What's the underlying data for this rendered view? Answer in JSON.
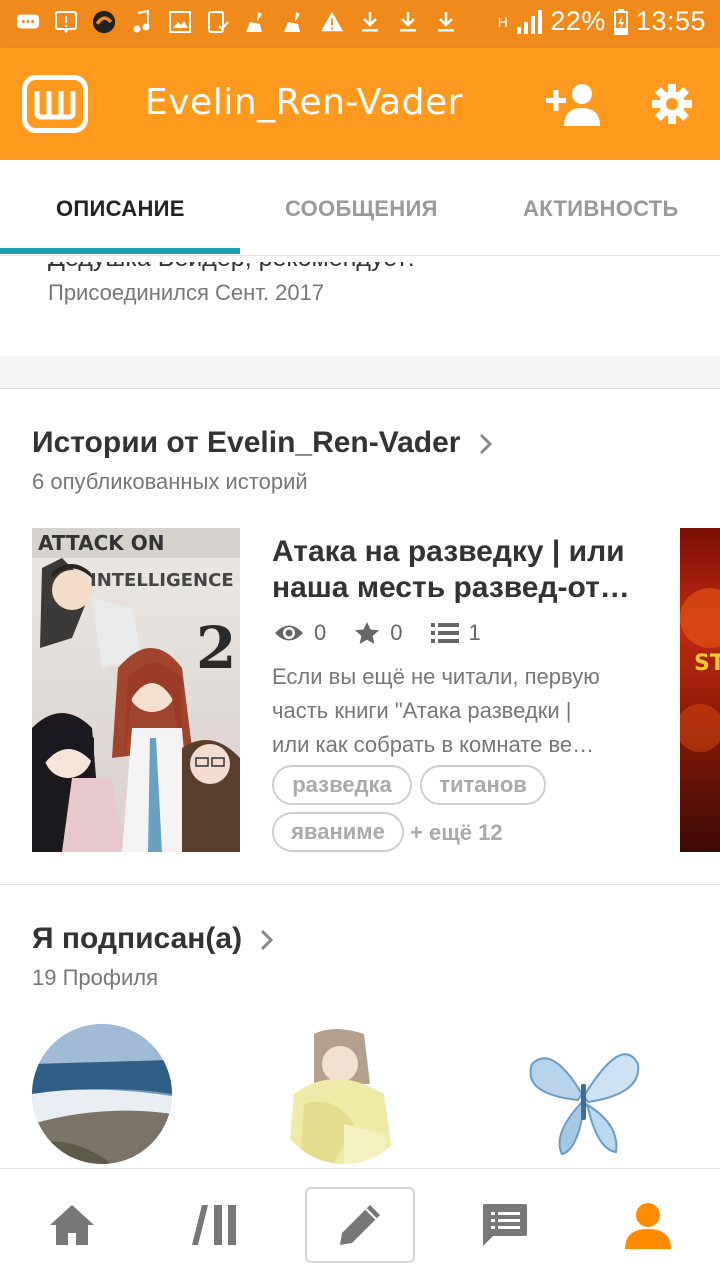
{
  "status_bar": {
    "battery_percent": "22%",
    "time": "13:55",
    "network": "H",
    "icons": [
      "message-icon",
      "alert-box-icon",
      "app-icon",
      "music-icon",
      "image-icon",
      "task-icon",
      "cleaner-icon",
      "cleaner-icon",
      "warning-icon",
      "download-icon",
      "download-icon",
      "download-icon"
    ]
  },
  "app_bar": {
    "title": "Evelin_Ren-Vader",
    "brand_color": "#ff9a1e"
  },
  "tabs": [
    {
      "label": "ОПИСАНИЕ",
      "active": true
    },
    {
      "label": "СООБЩЕНИЯ",
      "active": false
    },
    {
      "label": "АКТИВНОСТЬ",
      "active": false
    }
  ],
  "profile": {
    "about_partial": "Дедушка Вейдер, рекомендует!",
    "joined": "Присоединился Сент. 2017"
  },
  "stories": {
    "title": "Истории от Evelin_Ren-Vader",
    "subtitle": "6 опубликованных историй",
    "items": [
      {
        "cover_text_1": "ATTACK ON",
        "cover_text_2": "INTELLIGENCE",
        "cover_number": "2",
        "title_line1": "Атака на разведку | или",
        "title_line2": "наша месть развед-от…",
        "views": "0",
        "votes": "0",
        "parts": "1",
        "desc_line1": "Если вы ещё не читали, первую",
        "desc_line2": "часть книги \"Атака разведки |",
        "desc_line3": "или как собрать в комнате ве…",
        "tags": [
          "разведка",
          "титанов",
          "яваниме"
        ],
        "more_tags": "+ ещё 12"
      }
    ],
    "next_cover_text": "ST"
  },
  "following": {
    "title": "Я подписан(а)",
    "subtitle": "19 Профиля"
  },
  "bottom_nav": [
    "home-icon",
    "library-icon",
    "write-icon",
    "messages-icon",
    "profile-icon"
  ],
  "active_color": "#ff8c00"
}
